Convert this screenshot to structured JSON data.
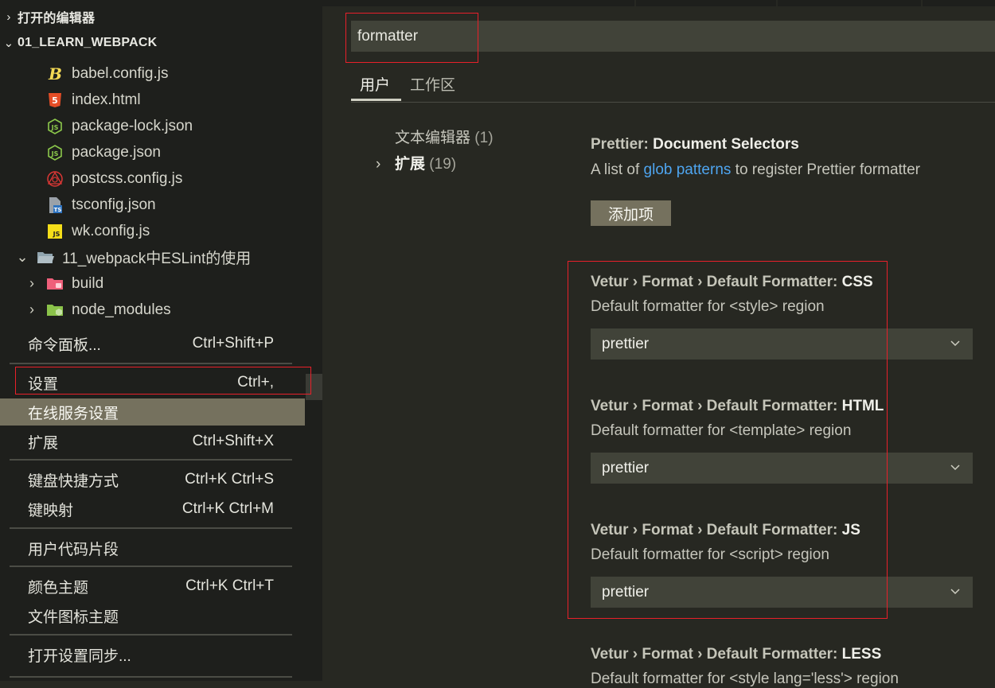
{
  "explorer": {
    "open_editors": "打开的编辑器",
    "project": "01_LEARN_WEBPACK",
    "files": [
      {
        "name": "babel.config.js",
        "icon": "babel-icon"
      },
      {
        "name": "index.html",
        "icon": "html5-icon"
      },
      {
        "name": "package-lock.json",
        "icon": "nodejs-icon"
      },
      {
        "name": "package.json",
        "icon": "nodejs-icon"
      },
      {
        "name": "postcss.config.js",
        "icon": "postcss-icon"
      },
      {
        "name": "tsconfig.json",
        "icon": "typescript-config-icon"
      },
      {
        "name": "wk.config.js",
        "icon": "javascript-icon"
      }
    ],
    "folder": "11_webpack中ESLint的使用",
    "subfolders": [
      {
        "name": "build",
        "icon": "folder-build-icon"
      },
      {
        "name": "node_modules",
        "icon": "folder-node-icon"
      }
    ]
  },
  "menu": {
    "items": [
      {
        "label": "命令面板...",
        "key": "Ctrl+Shift+P"
      },
      {
        "label": "设置",
        "key": "Ctrl+,"
      },
      {
        "label": "在线服务设置",
        "key": ""
      },
      {
        "label": "扩展",
        "key": "Ctrl+Shift+X"
      },
      {
        "label": "键盘快捷方式",
        "key": "Ctrl+K Ctrl+S"
      },
      {
        "label": "键映射",
        "key": "Ctrl+K Ctrl+M"
      },
      {
        "label": "用户代码片段",
        "key": ""
      },
      {
        "label": "颜色主题",
        "key": "Ctrl+K Ctrl+T"
      },
      {
        "label": "文件图标主题",
        "key": ""
      },
      {
        "label": "打开设置同步...",
        "key": ""
      }
    ]
  },
  "settings": {
    "search_value": "formatter",
    "tabs": {
      "user": "用户",
      "workspace": "工作区"
    },
    "toc": [
      {
        "label": "文本编辑器",
        "count": "(1)"
      },
      {
        "label": "扩展",
        "count": "(19)"
      }
    ],
    "items": [
      {
        "title_prefix": "Prettier: ",
        "title_final": "Document Selectors",
        "desc_before": "A list of ",
        "desc_link": "glob patterns",
        "desc_after": " to register Prettier formatter",
        "button": "添加项"
      },
      {
        "title_prefix": "Vetur › Format › Default Formatter: ",
        "title_final": "CSS",
        "desc": "Default formatter for <style> region",
        "value": "prettier"
      },
      {
        "title_prefix": "Vetur › Format › Default Formatter: ",
        "title_final": "HTML",
        "desc": "Default formatter for <template> region",
        "value": "prettier"
      },
      {
        "title_prefix": "Vetur › Format › Default Formatter: ",
        "title_final": "JS",
        "desc": "Default formatter for <script> region",
        "value": "prettier"
      },
      {
        "title_prefix": "Vetur › Format › Default Formatter: ",
        "title_final": "LESS",
        "desc": "Default formatter for <style lang='less'> region"
      }
    ]
  },
  "colors": {
    "highlight": "#75715e",
    "annotation_red": "#e8202a",
    "link": "#4ea5f0"
  }
}
